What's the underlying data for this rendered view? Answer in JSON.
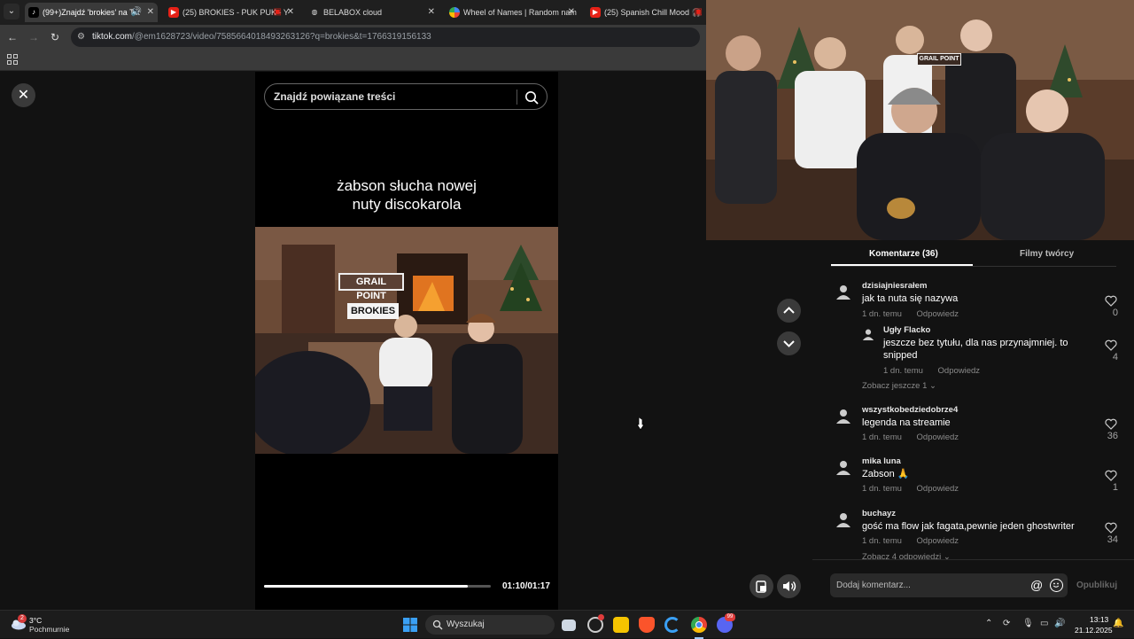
{
  "browser": {
    "tabs": [
      {
        "title": "(99+)Znajdź 'brokies' na Tik",
        "icon": "tiktok-icon",
        "active": true,
        "audio": true
      },
      {
        "title": "(25) BROKIES - PUK PUK - Y",
        "icon": "youtube-icon",
        "active": false
      },
      {
        "title": "BELABOX cloud",
        "icon": "globe-icon",
        "active": false
      },
      {
        "title": "Wheel of Names | Random nam",
        "icon": "wheel-icon",
        "active": false
      },
      {
        "title": "(25) Spanish Chill Mood 🎧",
        "icon": "youtube-icon",
        "active": false
      }
    ],
    "url_host": "tiktok.com",
    "url_path": "/@em1628723/video/7585664018493263126?q=brokies&t=1766319156133"
  },
  "video": {
    "search_placeholder": "Znajdź powiązane treści",
    "caption_line1": "żabson słucha nowej",
    "caption_line2": "nuty discokarola",
    "sign_text": "GRAIL POINT",
    "brand_text": "BROKIES",
    "time": "01:10/01:17",
    "progress": 0.9
  },
  "panel": {
    "tab_comments": "Komentarze (36)",
    "tab_creator": "Filmy twórcy",
    "comments": [
      {
        "user": "dzisiajniesrałem",
        "text": "jak ta nuta się nazywa",
        "time": "1 dn. temu",
        "reply": "Odpowiedz",
        "likes": "0"
      },
      {
        "user": "wszystkobedziedobrze4",
        "text": "legenda na streamie",
        "time": "1 dn. temu",
        "reply": "Odpowiedz",
        "likes": "36"
      },
      {
        "user": "mika luna",
        "text": "Zabson 🙏",
        "time": "1 dn. temu",
        "reply": "Odpowiedz",
        "likes": "1"
      },
      {
        "user": "buchayz",
        "text": "gość ma flow jak fagata,pewnie jeden ghostwriter",
        "time": "1 dn. temu",
        "reply": "Odpowiedz",
        "likes": "34"
      }
    ],
    "reply": {
      "user": "Ugły Flacko",
      "text": "jeszcze bez tytułu, dla nas przynajmniej. to snipped",
      "time": "1 dn. temu",
      "reply": "Odpowiedz",
      "likes": "4"
    },
    "see_more": "Zobacz jeszcze 1",
    "see_replies": "Zobacz 4 odpowiedzi",
    "comment_placeholder": "Dodaj komentarz...",
    "publish": "Opublikuj"
  },
  "stream": {
    "sign_text": "GRAIL POINT"
  },
  "taskbar": {
    "weather_temp": "3°C",
    "weather_desc": "Pochmurnie",
    "weather_badge": "2",
    "search_label": "Wyszukaj",
    "time": "13:13",
    "date": "21.12.2025",
    "discord_badge": "99"
  }
}
